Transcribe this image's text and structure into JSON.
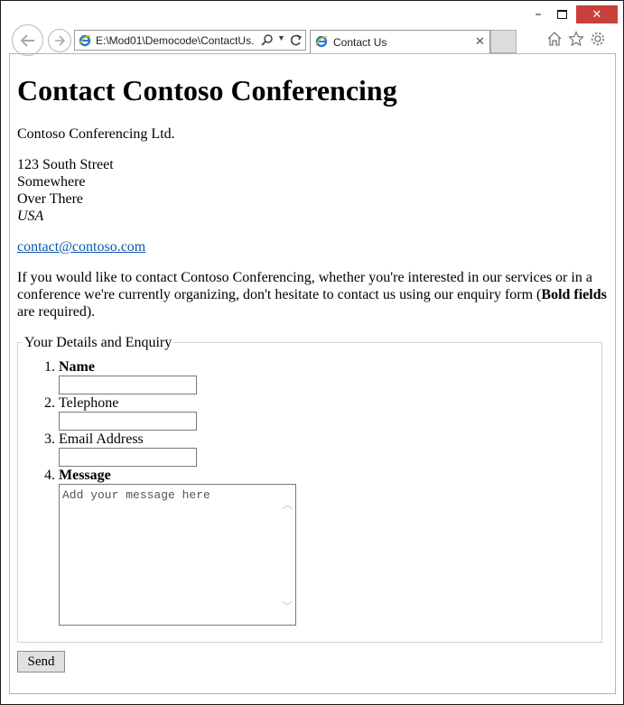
{
  "browser": {
    "address": "E:\\Mod01\\Democode\\ContactUs.",
    "tab_title": "Contact Us",
    "caption": {
      "minimize": "–",
      "close": "✕"
    },
    "tab_close": "✕"
  },
  "page": {
    "heading": "Contact Contoso Conferencing",
    "company": "Contoso Conferencing Ltd.",
    "address_lines": [
      "123 South Street",
      "Somewhere",
      "Over There",
      "USA"
    ],
    "email": "contact@contoso.com",
    "intro": {
      "before": "If you would like to contact Contoso Conferencing, whether you're interested in our services or in a conference we're currently organizing, don't hesitate to contact us using our enquiry form (",
      "bold": "Bold fields",
      "after": " are required)."
    },
    "form": {
      "legend": "Your Details and Enquiry",
      "fields": [
        {
          "number": "1.",
          "label": "Name",
          "required": true
        },
        {
          "number": "2.",
          "label": "Telephone",
          "required": false
        },
        {
          "number": "3.",
          "label": "Email Address",
          "required": false
        },
        {
          "number": "4.",
          "label": "Message",
          "required": true,
          "placeholder": "Add your message here"
        }
      ],
      "send_label": "Send"
    }
  },
  "colors": {
    "close_button": "#c7403a",
    "link": "#0b58b0"
  }
}
